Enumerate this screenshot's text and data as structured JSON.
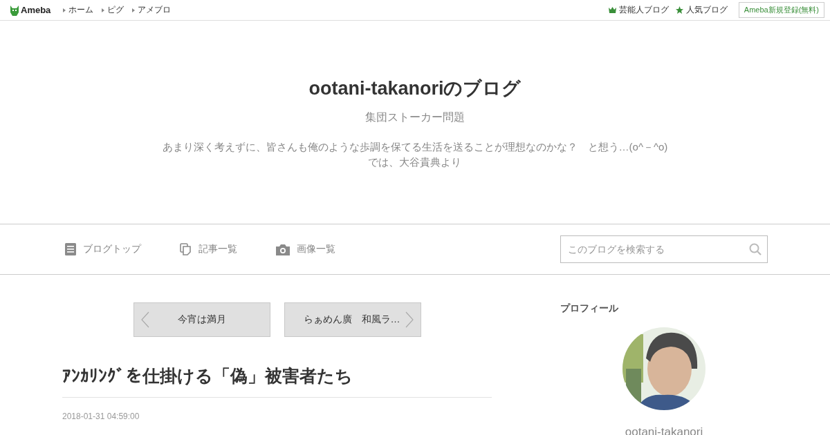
{
  "top_bar": {
    "logo": "Ameba",
    "links": [
      {
        "label": "ホーム"
      },
      {
        "label": "ピグ"
      },
      {
        "label": "アメブロ"
      }
    ],
    "right_links": [
      {
        "label": "芸能人ブログ",
        "kind": "crown"
      },
      {
        "label": "人気ブログ",
        "kind": "star"
      }
    ],
    "signup": "Ameba新規登録(無料)"
  },
  "header": {
    "title": "ootani-takanoriのブログ",
    "subtitle": "集団ストーカー問題",
    "description": [
      "あまり深く考えずに、皆さんも俺のような歩調を保てる生活を送ることが理想なのかな？　と想う…(o^－^o)",
      "では、大谷貴典より"
    ]
  },
  "nav": {
    "items": [
      {
        "label": "ブログトップ",
        "kind": "doc"
      },
      {
        "label": "記事一覧",
        "kind": "pages"
      },
      {
        "label": "画像一覧",
        "kind": "camera"
      }
    ],
    "search": {
      "placeholder": "このブログを検索する"
    }
  },
  "pager": {
    "prev": "今宵は満月",
    "next": "らぁめん廣　和風ラ…"
  },
  "article": {
    "title": "ｱﾝｶﾘﾝｸﾞを仕掛ける「偽」被害者たち",
    "date": "2018-01-31 04:59:00"
  },
  "sidebar": {
    "heading": "プロフィール",
    "name": "ootani-takanori"
  }
}
